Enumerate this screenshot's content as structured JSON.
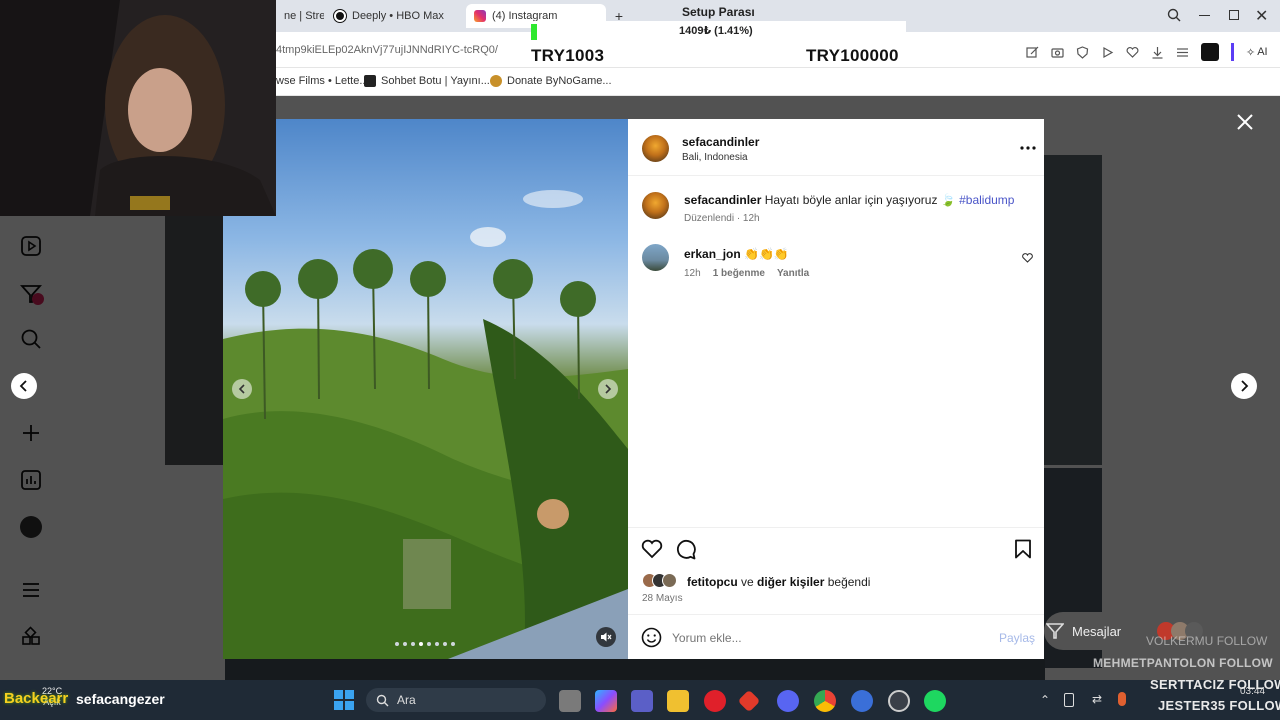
{
  "browser": {
    "tabs": [
      {
        "label": "ne | Strea"
      },
      {
        "label": "Deeply • HBO Max"
      },
      {
        "label": "(4) Instagram"
      }
    ],
    "url": "4tmp9kiELEp02AknVj77ujIJNNdRIYC-tcRQ0/",
    "toolbar_ai": "AI",
    "bookmarks": [
      {
        "label": "wse Films • Lette..."
      },
      {
        "label": "Sohbet Botu | Yayını..."
      },
      {
        "label": "Donate ByNoGame..."
      }
    ]
  },
  "overlay": {
    "title": "Setup Parası",
    "value": "1409₺ (1.41%)",
    "current": "TRY1003",
    "target": "TRY100000",
    "progress_percent": 1.41
  },
  "post": {
    "username": "sefacandinler",
    "location": "Bali, Indonesia",
    "caption_user": "sefacandinler",
    "caption": "Hayatı böyle anlar için yaşıyoruz 🍃",
    "hashtag": "#balidump",
    "edited": "Düzenlendi · 12h",
    "comment": {
      "user": "erkan_jon",
      "text": "👏👏👏",
      "time": "12h",
      "likes": "1 beğenme",
      "reply": "Yanıtla"
    },
    "liked_by_user": "fetitopcu",
    "liked_by_joiner": " ve ",
    "liked_by_others": "diğer kişiler",
    "liked_by_suffix": " beğendi",
    "date": "28 Mayıs",
    "comment_placeholder": "Yorum ekle...",
    "share_label": "Paylaş"
  },
  "messages_label": "Mesajlar",
  "stream": {
    "weather_temp": "22°C",
    "weather_state": "Açık",
    "backearr": "Backearr",
    "channel": "sefacangezer",
    "search_label": "Ara",
    "time": "03:44",
    "followers": [
      {
        "name": "VOLKERMU",
        "label": "FOLLOW"
      },
      {
        "name": "MEHMETPANTOLON",
        "label": "FOLLOW"
      },
      {
        "name": "SERTTACIZ",
        "label": "FOLLOW"
      },
      {
        "name": "JESTER35",
        "label": "FOLLOW"
      }
    ]
  },
  "colors": {
    "accent_link": "#4a55c8",
    "progress": "#2ee82e",
    "notification": "#e0245e"
  }
}
